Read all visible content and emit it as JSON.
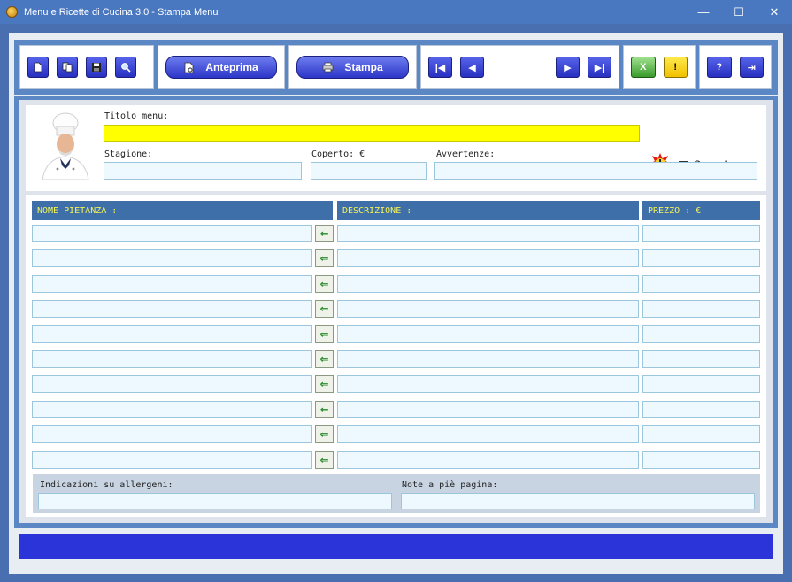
{
  "window": {
    "title": "Menu e Ricette di Cucina 3.0 - Stampa Menu",
    "minimize": "—",
    "maximize": "☐",
    "close": "✕"
  },
  "toolbar": {
    "new_icon": "new-doc-icon",
    "copy_icon": "copy-icon",
    "save_icon": "save-icon",
    "search_icon": "search-icon",
    "preview_label": "Anteprima",
    "print_label": "Stampa",
    "first_glyph": "|◀",
    "prev_glyph": "◀",
    "next_glyph": "▶",
    "last_glyph": "▶|",
    "excel_glyph": "X",
    "warning_glyph": "!",
    "help_glyph": "?",
    "exit_glyph": "⇥"
  },
  "form": {
    "title_label": "Titolo menu:",
    "title_value": "",
    "season_label": "Stagione:",
    "season_value": "",
    "cover_label": "Coperto: €",
    "cover_value": "",
    "warnings_label": "Avvertenze:",
    "warnings_value": "",
    "flagged_label": "Segnalato",
    "flagged_checked": false
  },
  "table": {
    "headers": [
      "NOME PIETANZA :",
      "DESCRIZIONE :",
      "PREZZO : €"
    ],
    "row_count": 10,
    "arrow_glyph": "⇐"
  },
  "footer": {
    "allergens_label": "Indicazioni su allergeni:",
    "allergens_value": "",
    "notes_label": "Note a piè pagina:",
    "notes_value": ""
  },
  "colors": {
    "accent": "#2a34d8",
    "header_bg": "#3f6fa8",
    "header_text": "#f2f259",
    "title_field": "#ffff00"
  }
}
